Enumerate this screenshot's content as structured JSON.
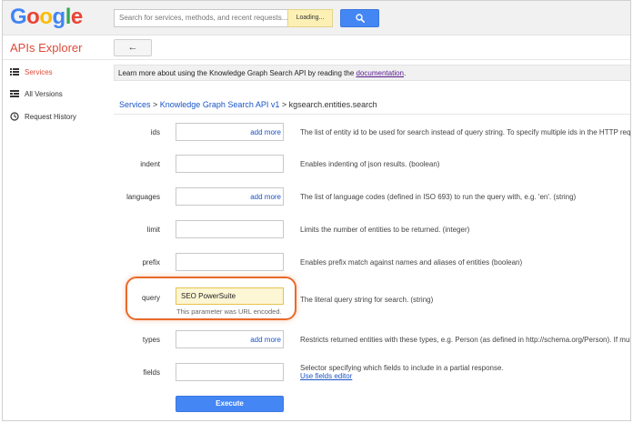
{
  "header": {
    "logo_letters": [
      {
        "ch": "G",
        "color": "#4285f4"
      },
      {
        "ch": "o",
        "color": "#ea4335"
      },
      {
        "ch": "o",
        "color": "#fbbc05"
      },
      {
        "ch": "g",
        "color": "#4285f4"
      },
      {
        "ch": "l",
        "color": "#34a853"
      },
      {
        "ch": "e",
        "color": "#ea4335"
      }
    ],
    "search_placeholder": "Search for services, methods, and recent requests...",
    "loading_label": "Loading...",
    "search_icon": "search-icon"
  },
  "app_title": "APIs Explorer",
  "back_label": "←",
  "sidebar": {
    "items": [
      {
        "label": "Services",
        "icon": "list-icon",
        "active": true
      },
      {
        "label": "All Versions",
        "icon": "versions-icon",
        "active": false
      },
      {
        "label": "Request History",
        "icon": "history-icon",
        "active": false
      }
    ]
  },
  "info": {
    "text": "Learn more about using the Knowledge Graph Search API by reading the ",
    "link": "documentation",
    "suffix": "."
  },
  "breadcrumb": {
    "services": "Services",
    "sep1": " > ",
    "api": "Knowledge Graph Search API v1",
    "sep2": " > ",
    "method": "kgsearch.entities.search"
  },
  "params": {
    "ids": {
      "label": "ids",
      "add_more": "add more",
      "desc": "The list of entity id to be used for search instead of query string. To specify multiple ids in the HTTP reques"
    },
    "indent": {
      "label": "indent",
      "desc": "Enables indenting of json results. (boolean)"
    },
    "languages": {
      "label": "languages",
      "add_more": "add more",
      "desc": "The list of language codes (defined in ISO 693) to run the query with, e.g. 'en'. (string)"
    },
    "limit": {
      "label": "limit",
      "desc": "Limits the number of entities to be returned. (integer)"
    },
    "prefix": {
      "label": "prefix",
      "desc": "Enables prefix match against names and aliases of entities (boolean)"
    },
    "query": {
      "label": "query",
      "value": "SEO PowerSuite",
      "note": "This parameter was URL encoded.",
      "desc": "The literal query string for search. (string)"
    },
    "types": {
      "label": "types",
      "add_more": "add more",
      "desc": "Restricts returned entities with these types, e.g. Person (as defined in http://schema.org/Person). If multipl"
    },
    "fields": {
      "label": "fields",
      "desc": "Selector specifying which fields to include in a partial response.",
      "link": "Use fields editor"
    }
  },
  "execute_label": "Execute",
  "colors": {
    "accent_blue": "#4486f4",
    "brand_red": "#dd4b39",
    "highlight": "#e86a2b"
  }
}
